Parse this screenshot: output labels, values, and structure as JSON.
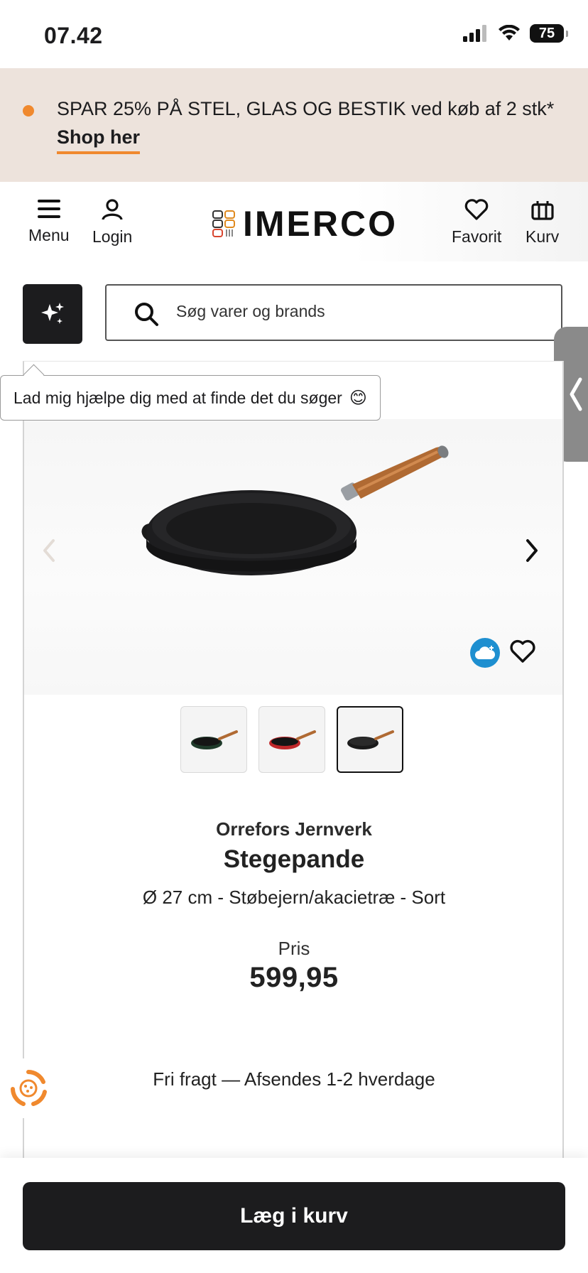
{
  "status_bar": {
    "time": "07.42",
    "battery": "75"
  },
  "promo": {
    "text": "SPAR 25% PÅ STEL, GLAS OG BESTIK ved køb af 2 stk*",
    "link": "Shop her",
    "accent_color": "#f0892e"
  },
  "header": {
    "menu_label": "Menu",
    "login_label": "Login",
    "logo_text": "IMERCO",
    "favorite_label": "Favorit",
    "cart_label": "Kurv"
  },
  "search": {
    "placeholder": "Søg varer og brands"
  },
  "assistant": {
    "tooltip": "Lad mig hjælpe dig med at finde det du søger",
    "tooltip_emoji": "😊"
  },
  "gallery": {
    "thumbnails": [
      {
        "color": "#1f3a2a",
        "icon": "pan-green-thumbnail"
      },
      {
        "color": "#c0282a",
        "icon": "pan-red-thumbnail"
      },
      {
        "color": "#1a1a1a",
        "icon": "pan-black-thumbnail"
      }
    ],
    "active_index": 2
  },
  "product": {
    "brand": "Orrefors Jernverk",
    "title": "Stegepande",
    "variant": "Ø 27 cm - Støbejern/akacietræ - Sort",
    "price_label": "Pris",
    "price": "599,95",
    "shipping": "Fri fragt — Afsendes 1-2 hverdage"
  },
  "cta": {
    "add_to_cart": "Læg i kurv"
  }
}
